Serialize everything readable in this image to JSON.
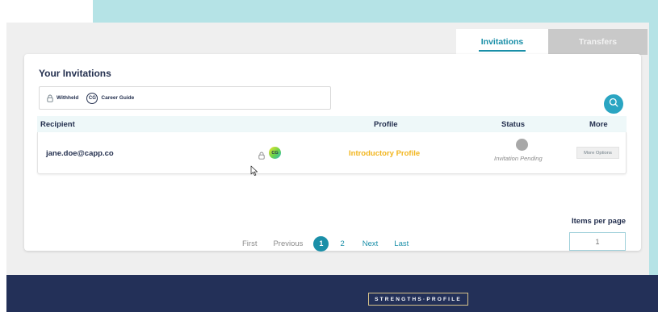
{
  "tabs": [
    {
      "label": "Invitations",
      "active": true
    },
    {
      "label": "Transfers",
      "active": false
    }
  ],
  "card": {
    "title": "Your Invitations",
    "filters": {
      "withheld_label": "Withheld",
      "cg_badge": "CG",
      "career_guide_label": "Career Guide"
    }
  },
  "table": {
    "headers": [
      "Recipient",
      "Profile",
      "Status",
      "More"
    ],
    "rows": [
      {
        "recipient": "jane.doe@capp.co",
        "badge": "CG",
        "profile": "Introductory Profile",
        "status": "Invitation Pending",
        "more_label": "More Options"
      }
    ]
  },
  "pagination": {
    "first": "First",
    "previous": "Previous",
    "pages": [
      "1",
      "2"
    ],
    "current_page": "1",
    "next": "Next",
    "last": "Last"
  },
  "items_per_page": {
    "label": "Items per page",
    "placeholder": "1"
  },
  "footer": {
    "logo_text": "STRENGTHS·PROFILE"
  },
  "colors": {
    "accent": "#1a8fa8",
    "navy": "#24304f",
    "profile_yellow": "#f2b51d",
    "footer": "#233058"
  },
  "icons": [
    "lock-icon",
    "search-icon",
    "cursor-icon"
  ]
}
